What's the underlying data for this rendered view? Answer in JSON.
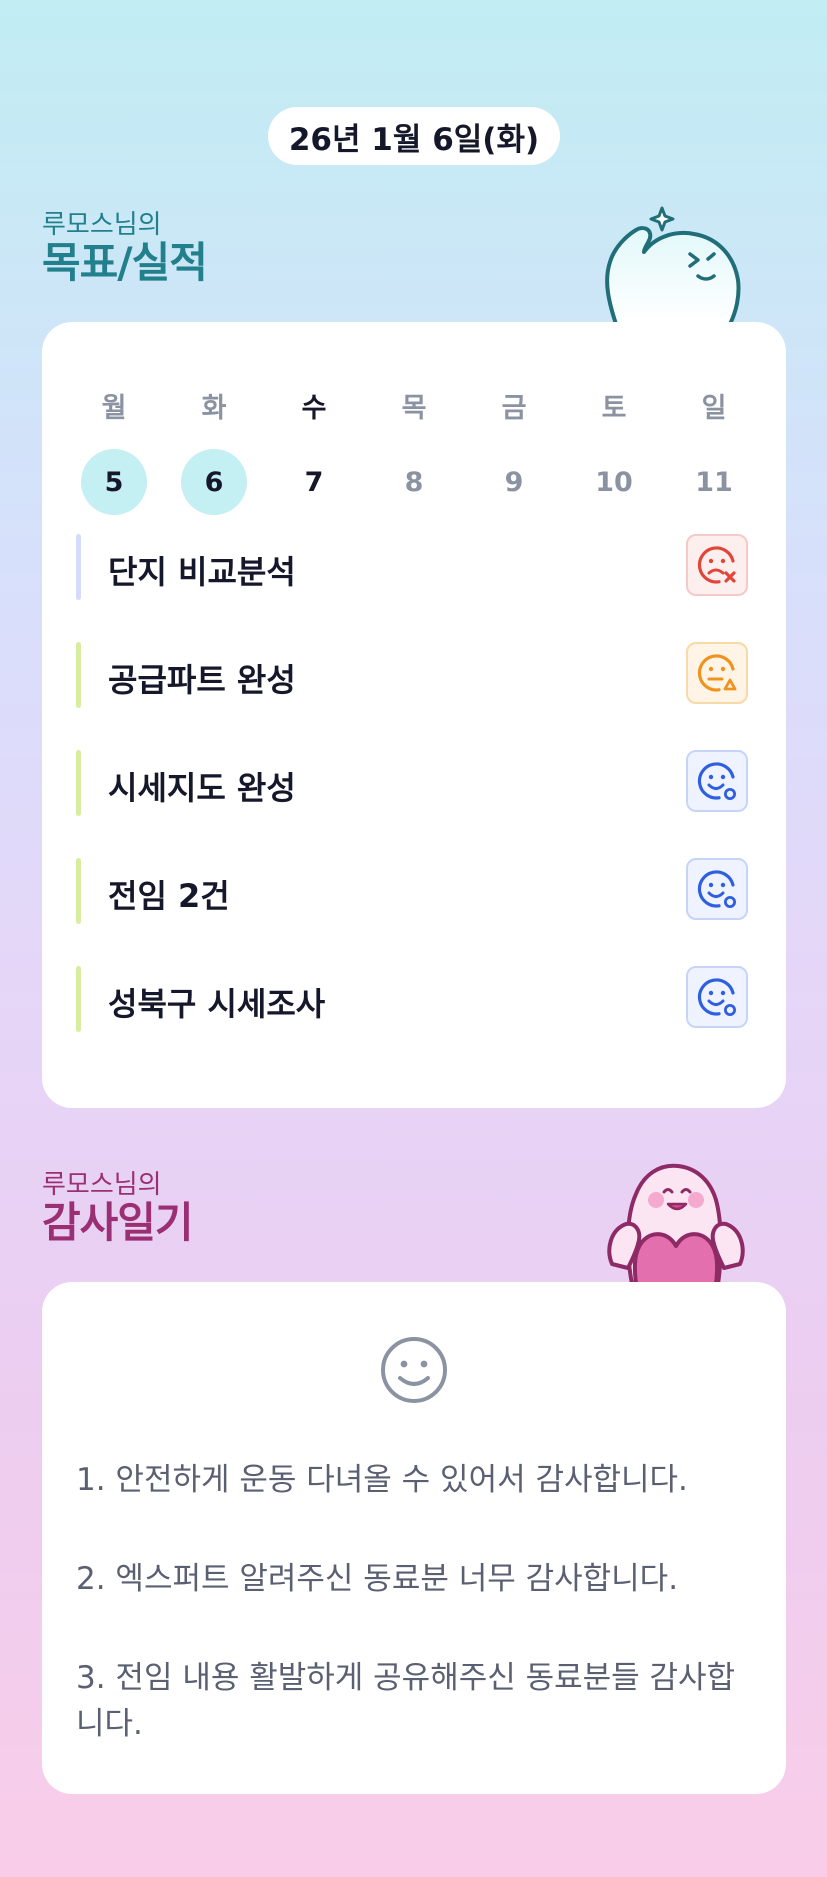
{
  "header": {
    "date": "26년 1월 6일(화)"
  },
  "goals_section": {
    "owner": "루모스님의",
    "title": "목표/실적"
  },
  "week": {
    "weekdays": [
      "월",
      "화",
      "수",
      "목",
      "금",
      "토",
      "일"
    ],
    "dates": [
      "5",
      "6",
      "7",
      "8",
      "9",
      "10",
      "11"
    ],
    "completed_dates": [
      "5",
      "6"
    ],
    "today": "7"
  },
  "goals": [
    {
      "text": "단지 비교분석",
      "status": "fail",
      "icon": "sad-x-face-icon"
    },
    {
      "text": "공급파트 완성",
      "status": "partial",
      "icon": "neutral-triangle-face-icon"
    },
    {
      "text": "시세지도 완성",
      "status": "done",
      "icon": "smile-circle-face-icon"
    },
    {
      "text": "전임 2건",
      "status": "done",
      "icon": "smile-circle-face-icon"
    },
    {
      "text": "성북구 시세조사",
      "status": "done",
      "icon": "smile-circle-face-icon"
    }
  ],
  "thanks_section": {
    "owner": "루모스님의",
    "title": "감사일기"
  },
  "thanks": {
    "mood_icon": "smile-face-icon",
    "items": [
      "1. 안전하게 운동 다녀올 수 있어서 감사합니다.",
      "2. 엑스퍼트 알려주신 동료분 너무 감사합니다.",
      "3. 전임 내용 활발하게 공유해주신 동료분들 감사합니다."
    ]
  },
  "colors": {
    "goals_title": "#21808c",
    "thanks_title": "#9b2f74",
    "done_day_circle": "#c4eff3",
    "status_fail": "#e2463a",
    "status_partial": "#f0931d",
    "status_done": "#2f5fe0"
  }
}
